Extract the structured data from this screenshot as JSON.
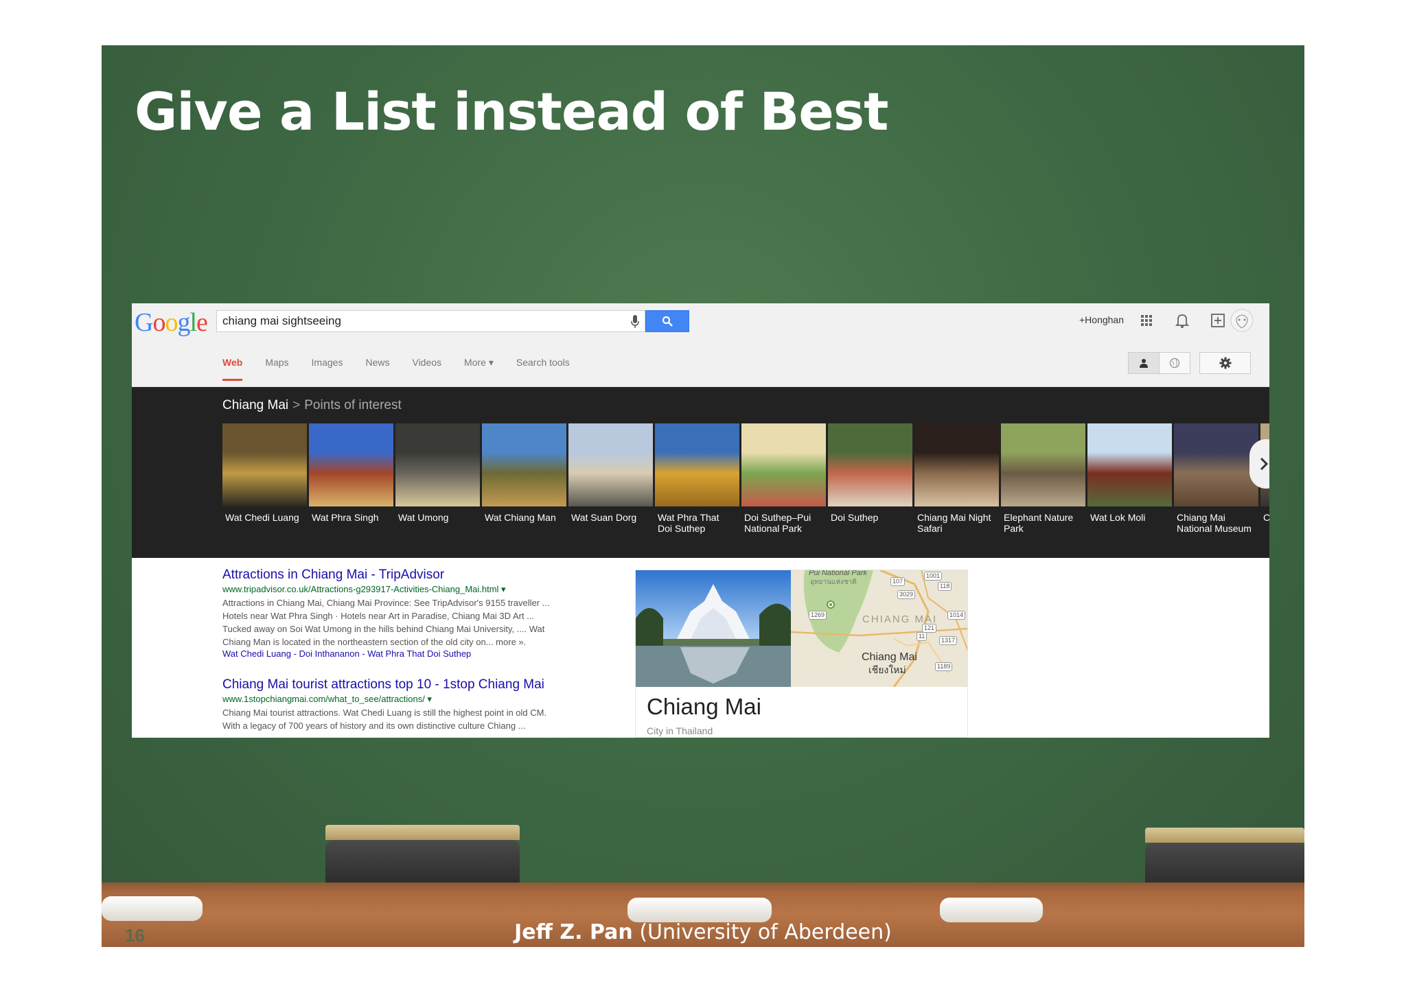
{
  "slide": {
    "title": "Give a List instead of Best",
    "page_number": "16",
    "footer_author": "Jeff Z. Pan",
    "footer_affiliation": " (University of  Aberdeen)"
  },
  "google": {
    "logo": [
      "G",
      "o",
      "o",
      "g",
      "l",
      "e"
    ],
    "query": "chiang mai sightseeing",
    "account": "+Honghan",
    "tabs": [
      "Web",
      "Maps",
      "Images",
      "News",
      "Videos",
      "More ▾",
      "Search tools"
    ],
    "active_tab": "Web",
    "icons": [
      "apps-grid-icon",
      "bell-icon",
      "share-plus-icon",
      "avatar"
    ]
  },
  "carousel": {
    "city": "Chiang Mai",
    "separator": ">",
    "category": "Points of interest",
    "items": [
      {
        "label": "Wat Chedi Luang",
        "colors": [
          "#6a5530",
          "#c09a45",
          "#2b2a22"
        ]
      },
      {
        "label": "Wat Phra Singh",
        "colors": [
          "#3a68c8",
          "#a3462a",
          "#d9b36a"
        ]
      },
      {
        "label": "Wat Umong",
        "colors": [
          "#3a3a36",
          "#6a665c",
          "#d9c79a"
        ]
      },
      {
        "label": "Wat Chiang Man",
        "colors": [
          "#4f86c8",
          "#6d6a35",
          "#c49b52"
        ]
      },
      {
        "label": "Wat Suan Dorg",
        "colors": [
          "#b8c9dd",
          "#d8cbb2",
          "#59574d"
        ]
      },
      {
        "label": "Wat Phra That\nDoi Suthep",
        "colors": [
          "#3b6fb8",
          "#d8a32f",
          "#9a6a22"
        ]
      },
      {
        "label": "Doi Suthep–Pui\nNational Park",
        "colors": [
          "#e9dcae",
          "#7aa650",
          "#c65a4a"
        ]
      },
      {
        "label": "Doi Suthep",
        "colors": [
          "#4e6a3a",
          "#c2674b",
          "#ddd4c3"
        ]
      },
      {
        "label": "Chiang Mai Night\nSafari",
        "colors": [
          "#2a1f1a",
          "#8b6a4c",
          "#d9c2a2"
        ]
      },
      {
        "label": "Elephant Nature\nPark",
        "colors": [
          "#8ea35b",
          "#6d5a44",
          "#b8a98c"
        ]
      },
      {
        "label": "Wat Lok Moli",
        "colors": [
          "#c8dcee",
          "#7a2e22",
          "#566b3a"
        ]
      },
      {
        "label": "Chiang Mai\nNational Museum",
        "colors": [
          "#3b3d5a",
          "#8a6f55",
          "#5c4532"
        ]
      },
      {
        "label": "C",
        "colors": [
          "#b7a480",
          "#6e5b3e",
          "#333"
        ]
      }
    ]
  },
  "results": [
    {
      "title": "Attractions in Chiang Mai - TripAdvisor",
      "url": "www.tripadvisor.co.uk/Attractions-g293917-Activities-Chiang_Mai.html ▾",
      "snippet": [
        "Attractions in Chiang Mai, Chiang Mai Province: See TripAdvisor's 9155 traveller ...",
        "Hotels near Wat Phra Singh · Hotels near Art in Paradise, Chiang Mai 3D Art ...",
        "Tucked away on Soi Wat Umong in the hills behind Chiang Mai University, .... Wat",
        "Chiang Man is located in the northeastern section of the old city on... more »."
      ],
      "links": "Wat Chedi Luang - Doi Inthananon - Wat Phra That Doi Suthep"
    },
    {
      "title": "Chiang Mai tourist attractions top 10 - 1stop Chiang Mai",
      "url": "www.1stopchiangmai.com/what_to_see/attractions/ ▾",
      "snippet": [
        "Chiang Mai tourist attractions. Wat Chedi Luang is still the highest point in old CM.",
        "With a legacy of 700 years of history and its own distinctive culture Chiang ..."
      ],
      "links": ""
    }
  ],
  "knowledge_panel": {
    "title": "Chiang Mai",
    "subtitle": "City in Thailand",
    "map": {
      "park_label": "Pui National Park",
      "park_label_thai": "อุทยานแห่งชาติ",
      "region_label": "CHIANG MAI",
      "city_label": "Chiang Mai",
      "city_label_thai": "เชียงใหม่",
      "road_numbers": [
        "1001",
        "107",
        "118",
        "3029",
        "1269",
        "1014",
        "121",
        "11",
        "1317",
        "1189"
      ]
    }
  },
  "colors": {
    "board": "#3f6a44",
    "google_blue": "#4285f4",
    "active_tab": "#dd4b39",
    "link": "#1a0dab",
    "url": "#006621",
    "carousel_bg": "#222222"
  }
}
